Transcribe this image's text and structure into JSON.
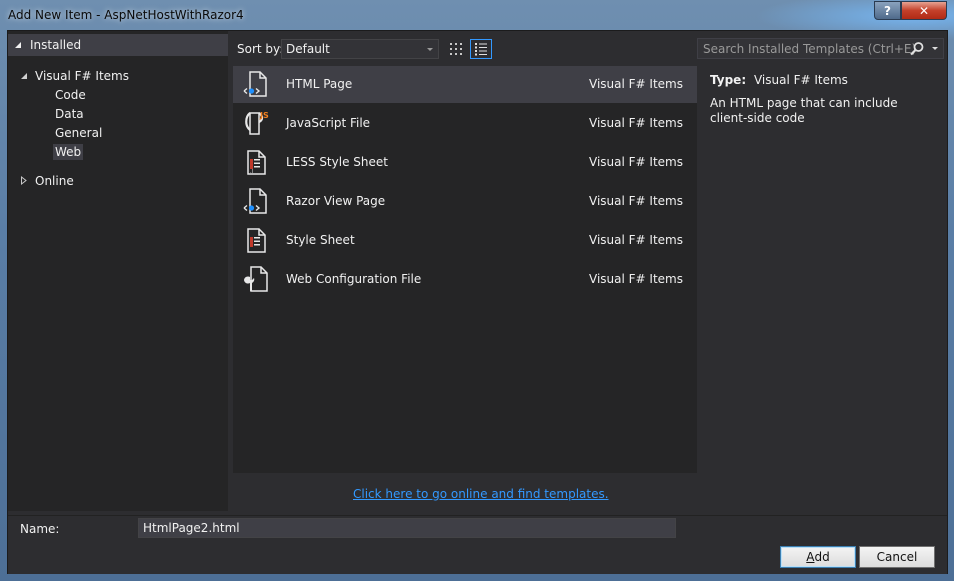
{
  "window": {
    "title": "Add New Item - AspNetHostWithRazor4",
    "help_label": "?",
    "close_label": "✕"
  },
  "tree": {
    "installed_label": "Installed",
    "root_label": "Visual F# Items",
    "children": [
      "Code",
      "Data",
      "General",
      "Web"
    ],
    "selected": "Web",
    "online_label": "Online"
  },
  "toolbar": {
    "sort_label": "Sort by:",
    "sort_value": "Default",
    "search_placeholder": "Search Installed Templates (Ctrl+E)"
  },
  "templates": [
    {
      "name": "HTML Page",
      "category": "Visual F# Items",
      "icon": "html-page-icon",
      "selected": true
    },
    {
      "name": "JavaScript File",
      "category": "Visual F# Items",
      "icon": "javascript-file-icon",
      "selected": false
    },
    {
      "name": "LESS Style Sheet",
      "category": "Visual F# Items",
      "icon": "less-stylesheet-icon",
      "selected": false
    },
    {
      "name": "Razor View Page",
      "category": "Visual F# Items",
      "icon": "razor-view-icon",
      "selected": false
    },
    {
      "name": "Style Sheet",
      "category": "Visual F# Items",
      "icon": "stylesheet-icon",
      "selected": false
    },
    {
      "name": "Web Configuration File",
      "category": "Visual F# Items",
      "icon": "web-config-icon",
      "selected": false
    }
  ],
  "description": {
    "type_key": "Type:",
    "type_value": "Visual F# Items",
    "text": "An HTML page that can include client-side code"
  },
  "online_link": "Click here to go online and find templates.",
  "name_field": {
    "label": "Name:",
    "value": "HtmlPage2.html"
  },
  "buttons": {
    "add_prefix": "A",
    "add_rest": "dd",
    "cancel": "Cancel"
  },
  "colors": {
    "accent": "#3399ff",
    "background": "#2d2d30",
    "panel": "#252526",
    "selection": "#3f3f46"
  }
}
